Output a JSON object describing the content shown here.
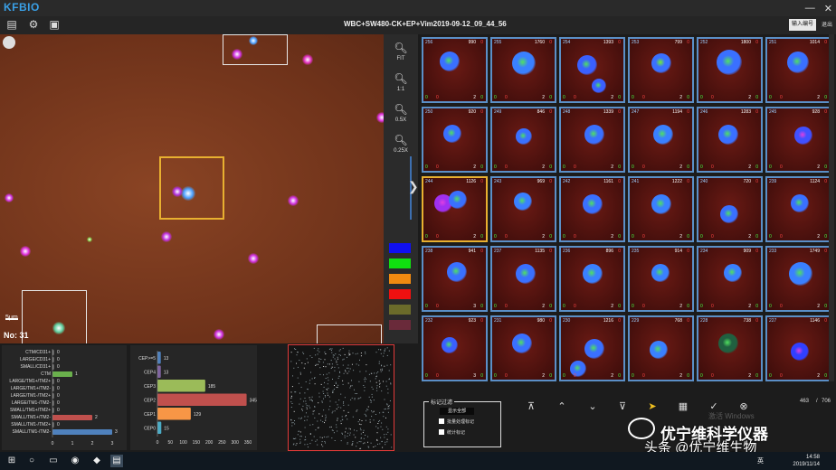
{
  "app": {
    "logo": "KFBIO",
    "title": "WBC+SW480-CK+EP+Vim2019-09-12_09_44_56",
    "input_code_button": "输入编号",
    "exit_button": "退出",
    "minimize": "—",
    "close": "✕"
  },
  "viewer": {
    "scale_label": "5μm",
    "number_label": "No: 31"
  },
  "zoom": [
    {
      "label": "FIT"
    },
    {
      "label": "1:1"
    },
    {
      "label": "0.5X"
    },
    {
      "label": "0.25X"
    }
  ],
  "swatches": [
    "#1010f0",
    "#10e010",
    "#f08a10",
    "#f01010",
    "#6b6b2a",
    "#6a2a3a"
  ],
  "chart_left": {
    "type": "bar",
    "categories": [
      "CTM/CD31+",
      "LARGE/CD31+",
      "SMALL/CD31+",
      "CTM",
      "LARGE/TM1+/TM2+",
      "LARGE/TM1+/TM2-",
      "LARGE/TM1-/TM2+",
      "LARGE/TM1-/TM2-",
      "SMALL/TM1+/TM2+",
      "SMALL/TM1+/TM2-",
      "SMALL/TM1-/TM2+",
      "SMALL/TM1-/TM2-"
    ],
    "values": [
      0,
      0,
      0,
      1,
      0,
      0,
      0,
      0,
      0,
      2,
      0,
      3
    ],
    "colors": [
      "#888",
      "#888",
      "#888",
      "#6ab04c",
      "#888",
      "#888",
      "#888",
      "#888",
      "#888",
      "#c0504d",
      "#888",
      "#4f81bd"
    ],
    "ticks": [
      "0",
      "1",
      "2",
      "3"
    ],
    "xlim": [
      0,
      3
    ]
  },
  "chart_mid": {
    "type": "bar",
    "categories": [
      "CEP>=5",
      "CEP4",
      "CEP3",
      "CEP2",
      "CEP1",
      "CEP0"
    ],
    "values": [
      13,
      13,
      185,
      345,
      129,
      15
    ],
    "colors": [
      "#4f81bd",
      "#8064a2",
      "#9bbb59",
      "#c0504d",
      "#f79646",
      "#4bacc6"
    ],
    "ticks": [
      "0",
      "50",
      "100",
      "150",
      "200",
      "250",
      "300",
      "350"
    ],
    "xlim": [
      0,
      350
    ]
  },
  "thumbnails": [
    {
      "idx": "256",
      "area": "990",
      "flag": "0",
      "b0": "0",
      "b1": "0",
      "b2": "2",
      "b3": "0"
    },
    {
      "idx": "255",
      "area": "1760",
      "flag": "0",
      "b0": "0",
      "b1": "0",
      "b2": "2",
      "b3": "0"
    },
    {
      "idx": "254",
      "area": "1393",
      "flag": "0",
      "b0": "0",
      "b1": "0",
      "b2": "2",
      "b3": "0"
    },
    {
      "idx": "253",
      "area": "799",
      "flag": "0",
      "b0": "0",
      "b1": "0",
      "b2": "2",
      "b3": "0"
    },
    {
      "idx": "252",
      "area": "1800",
      "flag": "0",
      "b0": "0",
      "b1": "0",
      "b2": "2",
      "b3": "0"
    },
    {
      "idx": "251",
      "area": "1014",
      "flag": "0",
      "b0": "0",
      "b1": "0",
      "b2": "2",
      "b3": "0"
    },
    {
      "idx": "250",
      "area": "920",
      "flag": "0",
      "b0": "0",
      "b1": "0",
      "b2": "2",
      "b3": "0"
    },
    {
      "idx": "249",
      "area": "846",
      "flag": "0",
      "b0": "0",
      "b1": "0",
      "b2": "2",
      "b3": "0"
    },
    {
      "idx": "248",
      "area": "1339",
      "flag": "0",
      "b0": "0",
      "b1": "0",
      "b2": "2",
      "b3": "0"
    },
    {
      "idx": "247",
      "area": "1194",
      "flag": "0",
      "b0": "0",
      "b1": "0",
      "b2": "2",
      "b3": "0"
    },
    {
      "idx": "246",
      "area": "1283",
      "flag": "0",
      "b0": "0",
      "b1": "0",
      "b2": "2",
      "b3": "0"
    },
    {
      "idx": "245",
      "area": "928",
      "flag": "0",
      "b0": "0",
      "b1": "0",
      "b2": "2",
      "b3": "0"
    },
    {
      "idx": "244",
      "area": "1126",
      "flag": "0",
      "b0": "0",
      "b1": "0",
      "b2": "2",
      "b3": "0"
    },
    {
      "idx": "243",
      "area": "969",
      "flag": "0",
      "b0": "0",
      "b1": "0",
      "b2": "2",
      "b3": "0"
    },
    {
      "idx": "242",
      "area": "1161",
      "flag": "0",
      "b0": "0",
      "b1": "0",
      "b2": "2",
      "b3": "0"
    },
    {
      "idx": "241",
      "area": "1222",
      "flag": "0",
      "b0": "0",
      "b1": "0",
      "b2": "2",
      "b3": "0"
    },
    {
      "idx": "240",
      "area": "720",
      "flag": "0",
      "b0": "0",
      "b1": "0",
      "b2": "2",
      "b3": "0"
    },
    {
      "idx": "239",
      "area": "1124",
      "flag": "0",
      "b0": "0",
      "b1": "0",
      "b2": "2",
      "b3": "0"
    },
    {
      "idx": "238",
      "area": "941",
      "flag": "0",
      "b0": "0",
      "b1": "0",
      "b2": "3",
      "b3": "0"
    },
    {
      "idx": "237",
      "area": "1135",
      "flag": "0",
      "b0": "0",
      "b1": "0",
      "b2": "2",
      "b3": "0"
    },
    {
      "idx": "236",
      "area": "896",
      "flag": "0",
      "b0": "0",
      "b1": "0",
      "b2": "2",
      "b3": "0"
    },
    {
      "idx": "235",
      "area": "914",
      "flag": "0",
      "b0": "0",
      "b1": "0",
      "b2": "2",
      "b3": "0"
    },
    {
      "idx": "234",
      "area": "909",
      "flag": "0",
      "b0": "0",
      "b1": "0",
      "b2": "2",
      "b3": "0"
    },
    {
      "idx": "233",
      "area": "1749",
      "flag": "0",
      "b0": "0",
      "b1": "0",
      "b2": "2",
      "b3": "0"
    },
    {
      "idx": "232",
      "area": "923",
      "flag": "0",
      "b0": "0",
      "b1": "0",
      "b2": "3",
      "b3": "0"
    },
    {
      "idx": "231",
      "area": "980",
      "flag": "0",
      "b0": "0",
      "b1": "0",
      "b2": "2",
      "b3": "0"
    },
    {
      "idx": "230",
      "area": "1216",
      "flag": "0",
      "b0": "0",
      "b1": "0",
      "b2": "2",
      "b3": "0"
    },
    {
      "idx": "229",
      "area": "768",
      "flag": "0",
      "b0": "0",
      "b1": "0",
      "b2": "2",
      "b3": "0"
    },
    {
      "idx": "228",
      "area": "738",
      "flag": "0",
      "b0": "0",
      "b1": "0",
      "b2": "2",
      "b3": "0"
    },
    {
      "idx": "227",
      "area": "1146",
      "flag": "0",
      "b0": "0",
      "b1": "0",
      "b2": "2",
      "b3": "0"
    }
  ],
  "filter": {
    "title": "标记过滤",
    "show_all": "显示全部",
    "batch_label": "批量处理标记",
    "stats_label": "统计标记"
  },
  "pager": {
    "current": "463",
    "total": "706"
  },
  "overlay": {
    "watermark": "激活 Windows",
    "brand_top": "优宁维科学仪器",
    "brand_sub": "头条 @优宁维生物"
  },
  "taskbar": {
    "time": "14:58",
    "date": "2019/11/14",
    "ime": "英"
  }
}
